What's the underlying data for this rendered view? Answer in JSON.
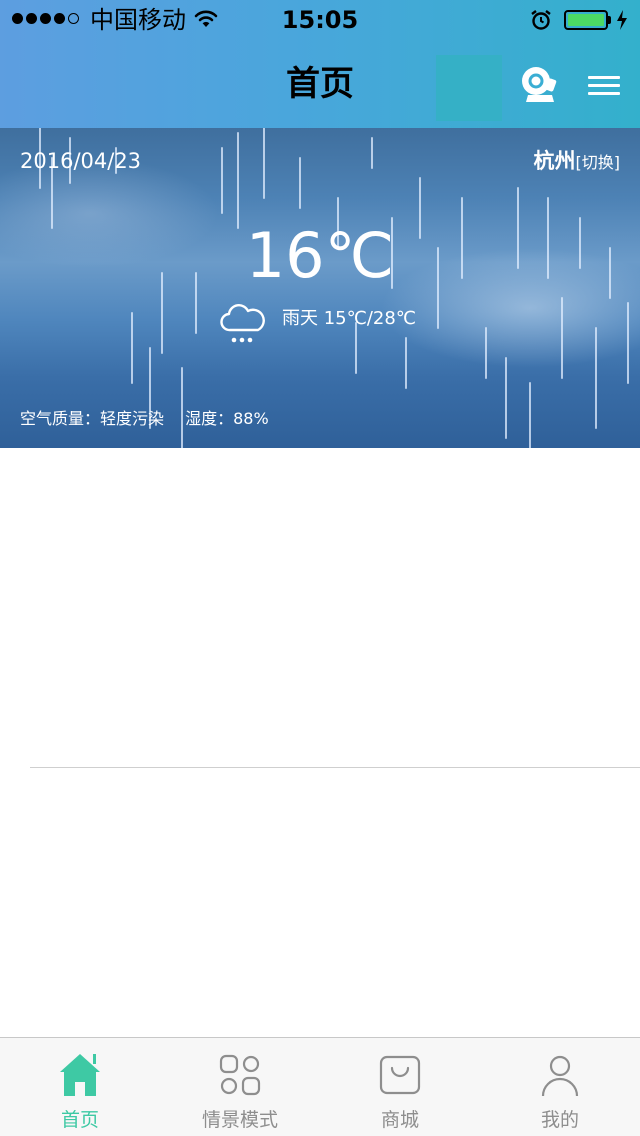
{
  "status_bar": {
    "carrier": "中国移动",
    "time": "15:05"
  },
  "nav": {
    "title": "首页",
    "camera_icon": "camera-icon",
    "menu_icon": "menu-icon"
  },
  "weather": {
    "date": "2016/04/23",
    "city": "杭州",
    "switch_label": "[切换]",
    "temperature": "16℃",
    "condition_icon": "rain-cloud-icon",
    "condition": "雨天 15℃/28℃",
    "air_quality": "空气质量：轻度污染",
    "humidity": "湿度：88%"
  },
  "tabs": [
    {
      "label": "首页",
      "icon": "home-icon",
      "active": true
    },
    {
      "label": "情景模式",
      "icon": "scene-grid-icon",
      "active": false
    },
    {
      "label": "商城",
      "icon": "shopping-bag-icon",
      "active": false
    },
    {
      "label": "我的",
      "icon": "profile-icon",
      "active": false
    }
  ],
  "colors": {
    "accent": "#3ec9a4",
    "header_start": "#5d9ee0",
    "header_end": "#33b0cc",
    "tab_inactive": "#8e8e8e"
  }
}
